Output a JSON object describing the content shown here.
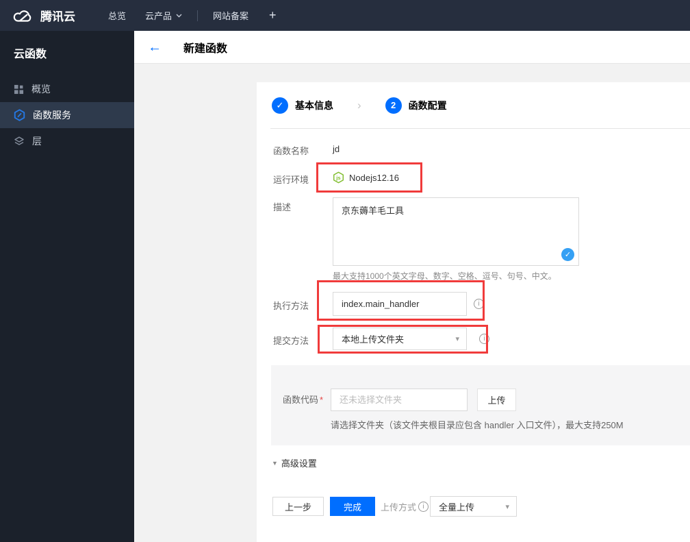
{
  "navbar": {
    "brand": "腾讯云",
    "overview": "总览",
    "products": "云产品",
    "icp": "网站备案",
    "plus": "+"
  },
  "sidebar": {
    "title": "云函数",
    "items": [
      {
        "label": "概览",
        "icon": "grid-icon",
        "selected": false
      },
      {
        "label": "函数服务",
        "icon": "function-hexagon-icon",
        "selected": true
      },
      {
        "label": "层",
        "icon": "layers-icon",
        "selected": false
      }
    ]
  },
  "page": {
    "back_arrow": "←",
    "title": "新建函数"
  },
  "steps": {
    "step1": {
      "icon": "✓",
      "label": "基本信息"
    },
    "chevron": "›",
    "step2": {
      "num": "2",
      "label": "函数配置"
    }
  },
  "form": {
    "name_label": "函数名称",
    "name_value": "jd",
    "runtime_label": "运行环境",
    "runtime_value": "Nodejs12.16",
    "desc_label": "描述",
    "desc_value": "京东薅羊毛工具",
    "desc_hint": "最大支持1000个英文字母、数字、空格、逗号、句号、中文。",
    "handler_label": "执行方法",
    "handler_value": "index.main_handler",
    "submit_label": "提交方法",
    "submit_value": "本地上传文件夹",
    "code_label": "函数代码",
    "code_required": "*",
    "code_placeholder": "还未选择文件夹",
    "upload_button": "上传",
    "code_hint": "请选择文件夹（该文件夹根目录应包含 handler 入口文件），最大支持250M",
    "advanced_label": "高级设置"
  },
  "footer": {
    "prev_button": "上一步",
    "finish_button": "完成",
    "upload_mode_label": "上传方式",
    "upload_mode_value": "全量上传"
  },
  "icons": {
    "info": "i",
    "caret_down": "▾",
    "triangle_down": "▼",
    "node_js": "js"
  },
  "colors": {
    "accent_blue": "#006eff",
    "annotation_red": "#f03b3b",
    "node_green": "#7fbd2c",
    "navbar_bg": "#262e3e",
    "sidebar_bg": "#1b212b",
    "sidebar_selected_bg": "#2e3a4c"
  }
}
